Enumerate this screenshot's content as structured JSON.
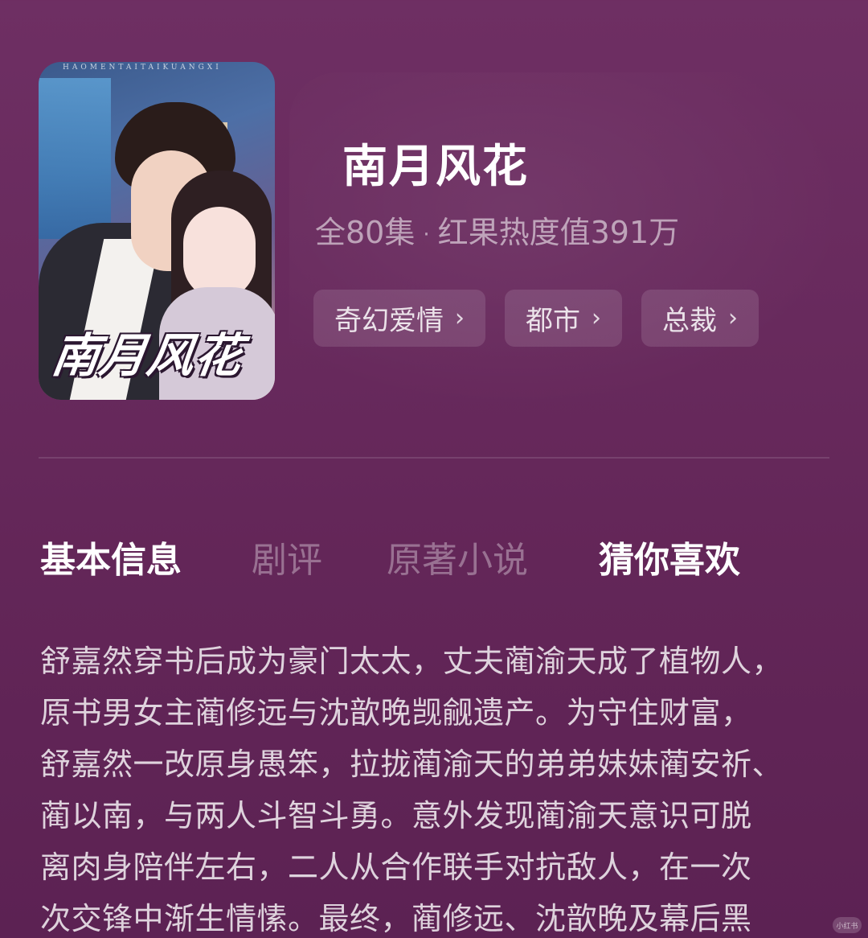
{
  "drama": {
    "title": "南月风花",
    "episodes": "全80集",
    "separator": "·",
    "heat": "红果热度值391万"
  },
  "poster": {
    "title_text": "南月风花",
    "top_text": "HAOMENTAITAIKUANGXI"
  },
  "tags": [
    {
      "label": "奇幻爱情",
      "chevron": "›"
    },
    {
      "label": "都市",
      "chevron": "›"
    },
    {
      "label": "总裁",
      "chevron": "›"
    }
  ],
  "tabs": [
    {
      "label": "基本信息",
      "state": "active"
    },
    {
      "label": "剧评",
      "state": "inactive"
    },
    {
      "label": "原著小说",
      "state": "inactive"
    },
    {
      "label": "猜你喜欢",
      "state": "bold"
    }
  ],
  "description": {
    "lines": [
      "舒嘉然穿书后成为豪门太太，丈夫蔺渝天成了植物人，",
      "原书男女主蔺修远与沈歆晚觊觎遗产。为守住财富，",
      "舒嘉然一改原身愚笨，拉拢蔺渝天的弟弟妹妹蔺安祈、",
      "蔺以南，与两人斗智斗勇。意外发现蔺渝天意识可脱",
      "离肉身陪伴左右，二人从合作联手对抗敌人，在一次",
      "次交锋中渐生情愫。最终，蔺修远、沈歆晚及幕后黑"
    ]
  },
  "watermark": "小红书",
  "colors": {
    "background": "#6a2c5f",
    "tag_bg": "rgba(255,255,255,0.12)"
  }
}
